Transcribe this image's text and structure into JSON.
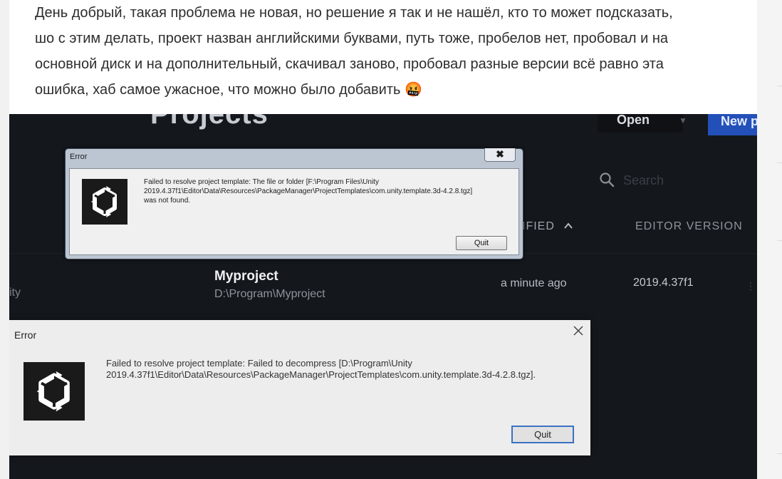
{
  "post": {
    "lines": [
      "День добрый, такая проблема не новая, но решение я так и не нашёл, кто то может подсказать,",
      "шо с этим делать, проект назван английскими буквами, путь тоже, пробелов нет, пробовал и на",
      "основной диск и на дополнительный, скачивал заново, пробовал разные версии всё равно эта",
      "ошибка, хаб самое ужасное, что можно было добавить 🤬"
    ]
  },
  "unity_hub": {
    "title": "Projects",
    "open_label": "Open",
    "new_label": "New p",
    "search_placeholder": "Search",
    "columns": {
      "modified": "IFIED",
      "editor_version": "EDITOR VERSION"
    },
    "left_cut_text": "ity",
    "project": {
      "name": "Myproject",
      "path": "D:\\Program\\Myproject",
      "modified": "a minute ago",
      "version": "2019.4.37f1"
    }
  },
  "dialog_win7": {
    "title": "Error",
    "close_symbol": "✖",
    "message_lines": [
      "Failed to resolve project template: The file or folder [F:\\Program Files\\Unity",
      "2019.4.37f1\\Editor\\Data\\Resources\\PackageManager\\ProjectTemplates\\com.unity.template.3d-4.2.8.tgz]",
      "was not found."
    ],
    "quit_label": "Quit"
  },
  "dialog_win10": {
    "title": "Error",
    "message_lines": [
      "Failed to resolve project template: Failed to decompress [D:\\Program\\Unity",
      "2019.4.37f1\\Editor\\Data\\Resources\\PackageManager\\ProjectTemplates\\com.unity.template.3d-4.2.8.tgz]."
    ],
    "quit_label": "Quit"
  }
}
